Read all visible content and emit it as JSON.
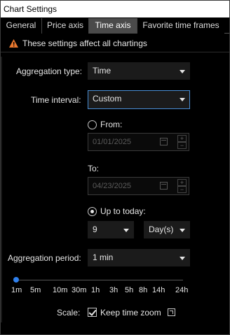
{
  "window": {
    "title": "Chart Settings"
  },
  "tabs": [
    {
      "label": "General"
    },
    {
      "label": "Price axis"
    },
    {
      "label": "Time axis"
    },
    {
      "label": "Favorite time frames"
    }
  ],
  "notice": {
    "text": "These settings affect all chartings",
    "icon": "warning-icon",
    "color": "#e8772e"
  },
  "aggregation_type": {
    "label": "Aggregation type:",
    "value": "Time"
  },
  "time_interval": {
    "label": "Time interval:",
    "value": "Custom"
  },
  "from": {
    "label": "From:",
    "value": "01/01/2025",
    "selected": false
  },
  "to": {
    "label": "To:",
    "value": "04/23/2025"
  },
  "up_to_today": {
    "label": "Up to today:",
    "selected": true,
    "count": "9",
    "unit": "Day(s)"
  },
  "aggregation_period": {
    "label": "Aggregation period:",
    "value": "1 min"
  },
  "slider": {
    "ticks": [
      "1m",
      "5m",
      "10m",
      "30m",
      "1h",
      "3h",
      "5h",
      "8h",
      "14h",
      "24h"
    ],
    "selected_index": 0,
    "accent": "#2f80ed"
  },
  "scale": {
    "label": "Scale:",
    "checkbox_label": "Keep time zoom",
    "checked": true
  }
}
